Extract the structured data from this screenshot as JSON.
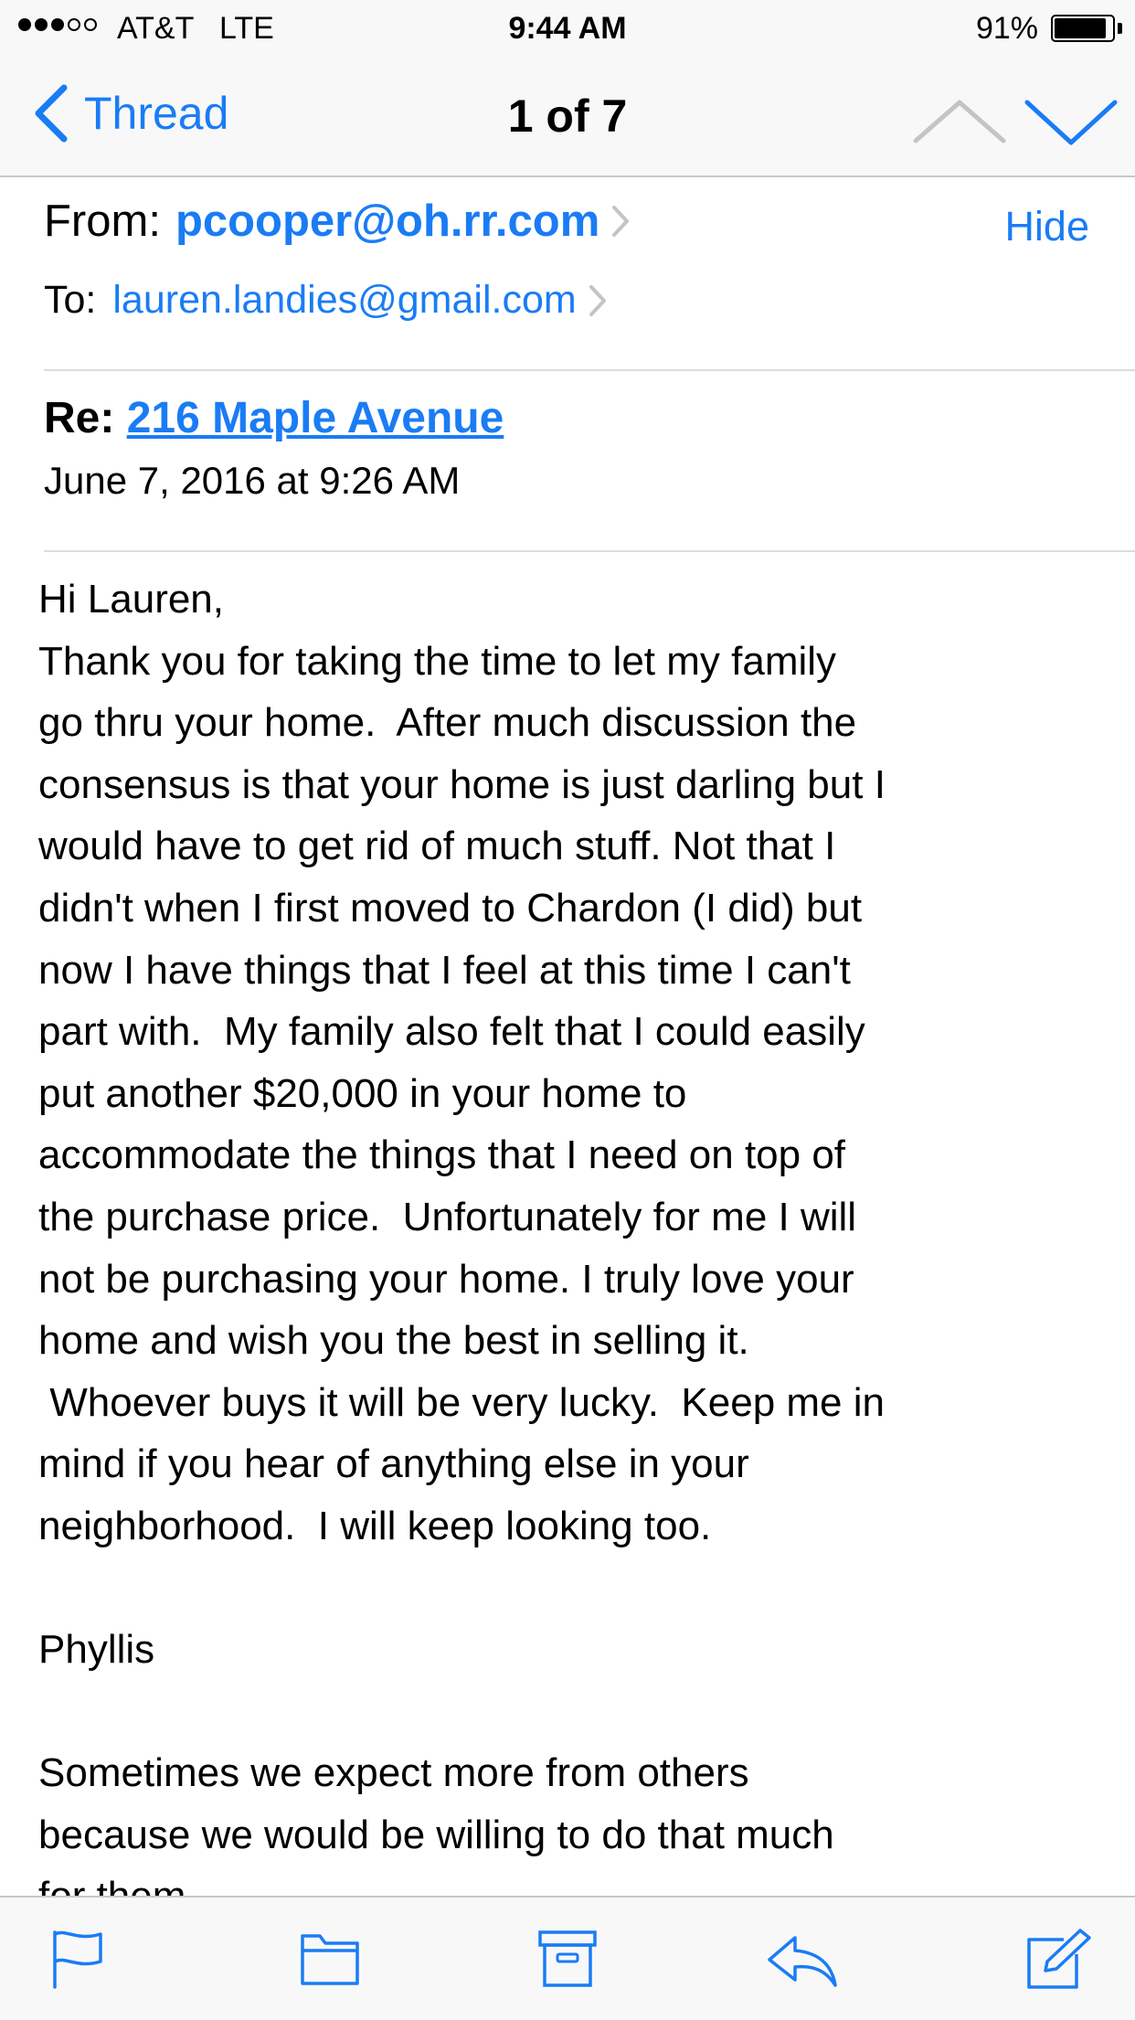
{
  "status_bar": {
    "carrier": "AT&T",
    "network": "LTE",
    "time": "9:44 AM",
    "battery": "91%",
    "signal_strength": 3
  },
  "nav": {
    "back_label": "Thread",
    "title": "1 of 7",
    "icons": [
      "chevron-left-icon",
      "chevron-up-icon",
      "chevron-down-icon"
    ]
  },
  "email": {
    "from_label": "From:",
    "from": "pcooper@oh.rr.com",
    "to_label": "To:",
    "to": "lauren.landies@gmail.com",
    "hide_label": "Hide",
    "subject_prefix": "Re:",
    "subject": "216 Maple Avenue",
    "date": "June 7, 2016 at 9:26 AM",
    "body_lines": [
      "Hi Lauren,",
      "Thank you for taking the time to let my family",
      "go thru your home.  After much discussion the",
      "consensus is that your home is just darling but I",
      "would have to get rid of much stuff. Not that I",
      "didn't when I first moved to Chardon (I did) but",
      "now I have things that I feel at this time I can't",
      "part with.  My family also felt that I could easily",
      "put another $20,000 in your home to",
      "accommodate the things that I need on top of",
      "the purchase price.  Unfortunately for me I will",
      "not be purchasing your home. I truly love your",
      "home and wish you the best in selling it.",
      " Whoever buys it will be very lucky.  Keep me in",
      "mind if you hear of anything else in your",
      "neighborhood.  I will keep looking too.",
      "",
      "Phyllis",
      "",
      "Sometimes we expect more from others",
      "because we would be willing to do that much",
      "for them."
    ]
  },
  "toolbar": {
    "icons": [
      "flag-icon",
      "folder-icon",
      "archive-icon",
      "reply-icon",
      "compose-icon"
    ]
  },
  "colors": {
    "accent": "#1a7cf5",
    "bar_bg": "#f8f8f8",
    "separator": "#c8c7cc"
  }
}
